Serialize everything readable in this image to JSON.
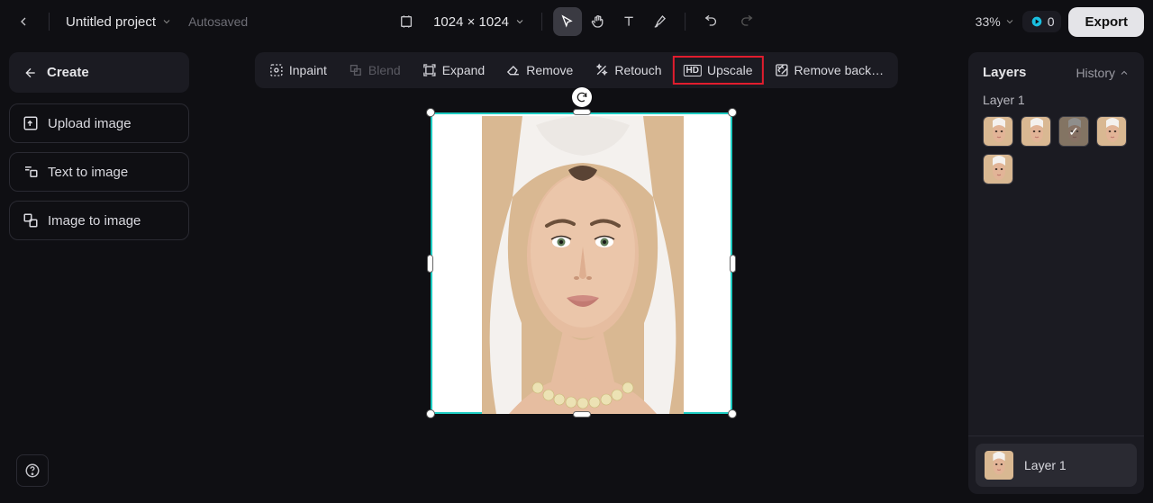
{
  "topbar": {
    "project_name": "Untitled project",
    "autosaved": "Autosaved",
    "dimensions": "1024 × 1024",
    "zoom": "33%",
    "credits": "0",
    "export_label": "Export"
  },
  "create_panel": {
    "title": "Create",
    "actions": {
      "upload": "Upload image",
      "t2i": "Text to image",
      "i2i": "Image to image"
    }
  },
  "context_toolbar": {
    "inpaint": "Inpaint",
    "blend": "Blend",
    "expand": "Expand",
    "remove": "Remove",
    "retouch": "Retouch",
    "upscale": "Upscale",
    "remove_bg": "Remove back…"
  },
  "layers_panel": {
    "title": "Layers",
    "history_label": "History",
    "active_layer_name": "Layer 1",
    "thumb_count": 5,
    "selected_thumb_index": 2,
    "layer_rows": [
      {
        "name": "Layer 1"
      }
    ]
  },
  "colors": {
    "skin": "#e2b497",
    "bg_beige": "#d9b892",
    "towel": "#f4f1ee",
    "necklace": "#e8d9a3"
  }
}
